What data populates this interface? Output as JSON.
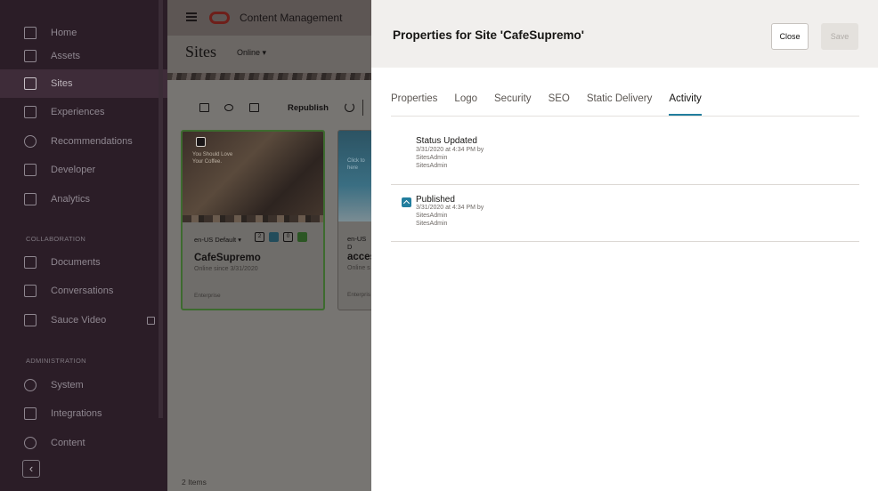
{
  "sidebar": {
    "items": [
      {
        "label": "Home",
        "icon": "home-icon"
      },
      {
        "label": "Assets",
        "icon": "assets-icon"
      },
      {
        "label": "Sites",
        "icon": "sites-icon"
      },
      {
        "label": "Experiences",
        "icon": "experiences-icon"
      },
      {
        "label": "Recommendations",
        "icon": "recommendations-icon"
      },
      {
        "label": "Developer",
        "icon": "developer-icon"
      },
      {
        "label": "Analytics",
        "icon": "analytics-icon"
      }
    ],
    "collaboration_label": "COLLABORATION",
    "collab_items": [
      {
        "label": "Documents",
        "icon": "documents-icon"
      },
      {
        "label": "Conversations",
        "icon": "conversations-icon"
      },
      {
        "label": "Sauce Video",
        "icon": "video-icon"
      }
    ],
    "administration_label": "ADMINISTRATION",
    "admin_items": [
      {
        "label": "System",
        "icon": "gear-icon"
      },
      {
        "label": "Integrations",
        "icon": "integrations-icon"
      },
      {
        "label": "Content",
        "icon": "content-icon"
      }
    ],
    "collapse_glyph": "‹"
  },
  "topbar": {
    "app_title": "Content Management"
  },
  "sites": {
    "title": "Sites",
    "filter": "Online ▾",
    "republish_label": "Republish",
    "items_count": "2 Items"
  },
  "cards": [
    {
      "lang": "en-US Default ▾",
      "name": "CafeSupremo",
      "subtitle": "Online since 3/31/2020",
      "type": "Enterprise",
      "image_text": "You Should Love Your Coffee.",
      "badge_count": "2",
      "badge_zero": "0"
    },
    {
      "lang": "en-US D",
      "name": "acces",
      "subtitle": "Online s",
      "type": "Enterpris",
      "image_text": "Click to here"
    }
  ],
  "panel": {
    "title": "Properties for Site 'CafeSupremo'",
    "close_label": "Close",
    "save_label": "Save",
    "tabs": [
      "Properties",
      "Logo",
      "Security",
      "SEO",
      "Static Delivery",
      "Activity"
    ],
    "active_tab": "Activity",
    "activities": [
      {
        "title": "Status Updated",
        "timestamp": "3/31/2020 at 4:34 PM by",
        "user1": "SitesAdmin",
        "user2": "SitesAdmin"
      },
      {
        "title": "Published",
        "timestamp": "3/31/2020 at 4:34 PM by",
        "user1": "SitesAdmin",
        "user2": "SitesAdmin"
      }
    ]
  },
  "colors": {
    "sidebar_bg": "#2b1d27",
    "accent": "#227e9e",
    "selected_card_border": "#3d6b2f"
  }
}
